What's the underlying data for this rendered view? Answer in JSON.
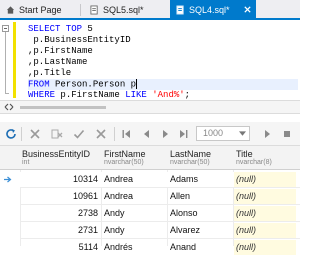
{
  "tabs": [
    {
      "label": "Start Page",
      "icon": "home-icon"
    },
    {
      "label": "SQL5.sql*",
      "icon": "sql-file-icon"
    },
    {
      "label": "SQL4.sql*",
      "icon": "sql-file-icon",
      "active": true
    }
  ],
  "colors": {
    "accent": "#007acc",
    "keyword": "#0000ff",
    "string": "#ff0000",
    "change_bar": "#f2e100"
  },
  "editor": {
    "lines": [
      {
        "kw": "SELECT TOP",
        "rest": " 5"
      },
      {
        "text": " p.BusinessEntityID"
      },
      {
        "text": ",p.FirstName"
      },
      {
        "text": ",p.LastName"
      },
      {
        "text": ",p.Title"
      },
      {
        "kw": "FROM",
        "rest": " Person.Person p"
      },
      {
        "kw": "WHERE",
        "rest": " p.FirstName ",
        "kw2": "LIKE",
        "str": " 'And%'",
        "end": ";"
      }
    ]
  },
  "toolbar": {
    "rows_value": "1000",
    "buttons": [
      "refresh-icon",
      "cancel-icon",
      "delete-row-icon",
      "apply-icon",
      "discard-icon",
      "first-page-icon",
      "prev-page-icon",
      "next-page-icon",
      "last-page-icon",
      "stop-icon"
    ]
  },
  "grid": {
    "columns": [
      {
        "name": "BusinessEntityID",
        "type": "int"
      },
      {
        "name": "FirstName",
        "type": "nvarchar(50)"
      },
      {
        "name": "LastName",
        "type": "nvarchar(50)"
      },
      {
        "name": "Title",
        "type": "nvarchar(8)"
      }
    ],
    "rows": [
      {
        "id": "10314",
        "first": "Andrea",
        "last": "Adams",
        "title": "(null)"
      },
      {
        "id": "10961",
        "first": "Andrea",
        "last": "Allen",
        "title": "(null)"
      },
      {
        "id": "2738",
        "first": "Andy",
        "last": "Alonso",
        "title": "(null)"
      },
      {
        "id": "2731",
        "first": "Andy",
        "last": "Alvarez",
        "title": "(null)"
      },
      {
        "id": "5114",
        "first": "Andrés",
        "last": "Anand",
        "title": "(null)"
      }
    ]
  }
}
